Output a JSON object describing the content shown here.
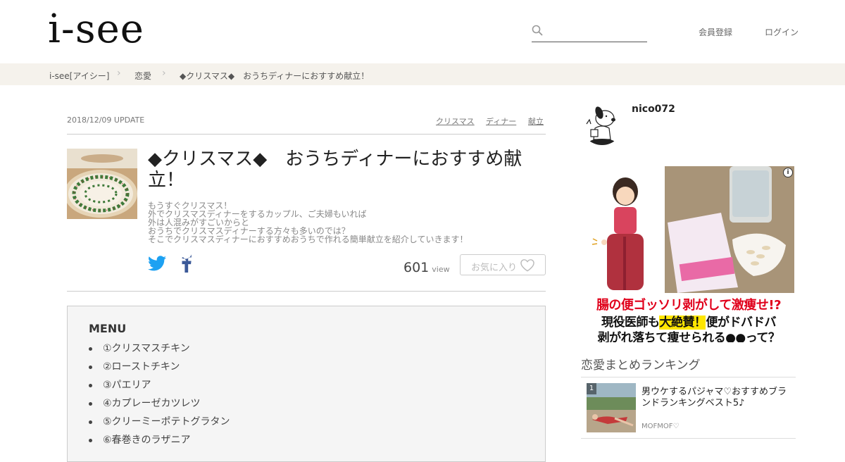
{
  "header": {
    "logo": "i-see",
    "search_placeholder": "",
    "register": "会員登録",
    "login": "ログイン"
  },
  "breadcrumb": [
    "i-see[アイシー]",
    "恋愛",
    "◆クリスマス◆　おうちディナーにおすすめ献立！"
  ],
  "article": {
    "date": "2018/12/09 UPDATE",
    "tags": [
      "クリスマス",
      "ディナー",
      "献立"
    ],
    "title": "◆クリスマス◆　おうちディナーにおすすめ献立！",
    "description": [
      "もうすぐクリスマス！",
      "外でクリスマスディナーをするカップル、ご夫婦もいれば",
      "外は人混みがすごいからと",
      "おうちでクリスマスディナーする方々も多いのでは？",
      "そこでクリスマスディナーにおすすめおうちで作れる簡単献立を紹介していきます！"
    ],
    "views": "601",
    "views_unit": "view",
    "favorite": "お気に入り"
  },
  "menu": {
    "heading": "MENU",
    "items": [
      "①クリスマスチキン",
      "②ローストチキン",
      "③パエリア",
      "④カプレーゼカツレツ",
      "⑤クリーミーポテトグラタン",
      "⑥春巻きのラザニア"
    ]
  },
  "author": {
    "name": "nico072"
  },
  "ad": {
    "line1": "腸の便ゴッソリ剥がして激痩せ!?",
    "line2_a": "現役医師も",
    "line2_b": "大絶賛！",
    "line2_c": "便がドバドバ",
    "line3": "剥がれ落ちて痩せられる●●って？",
    "info": "i"
  },
  "ranking": {
    "title": "恋愛まとめランキング",
    "items": [
      {
        "rank": "1",
        "title": "男ウケするパジャマ♡おすすめブランドランキングベスト5♪",
        "author": "MOFMOF♡"
      }
    ]
  },
  "colors": {
    "breadcrumb_bg": "#f5f2ec",
    "menu_bg": "#f5f5f5",
    "twitter": "#1da1f2",
    "facebook": "#3b5998",
    "ad_red": "#e0001b"
  }
}
